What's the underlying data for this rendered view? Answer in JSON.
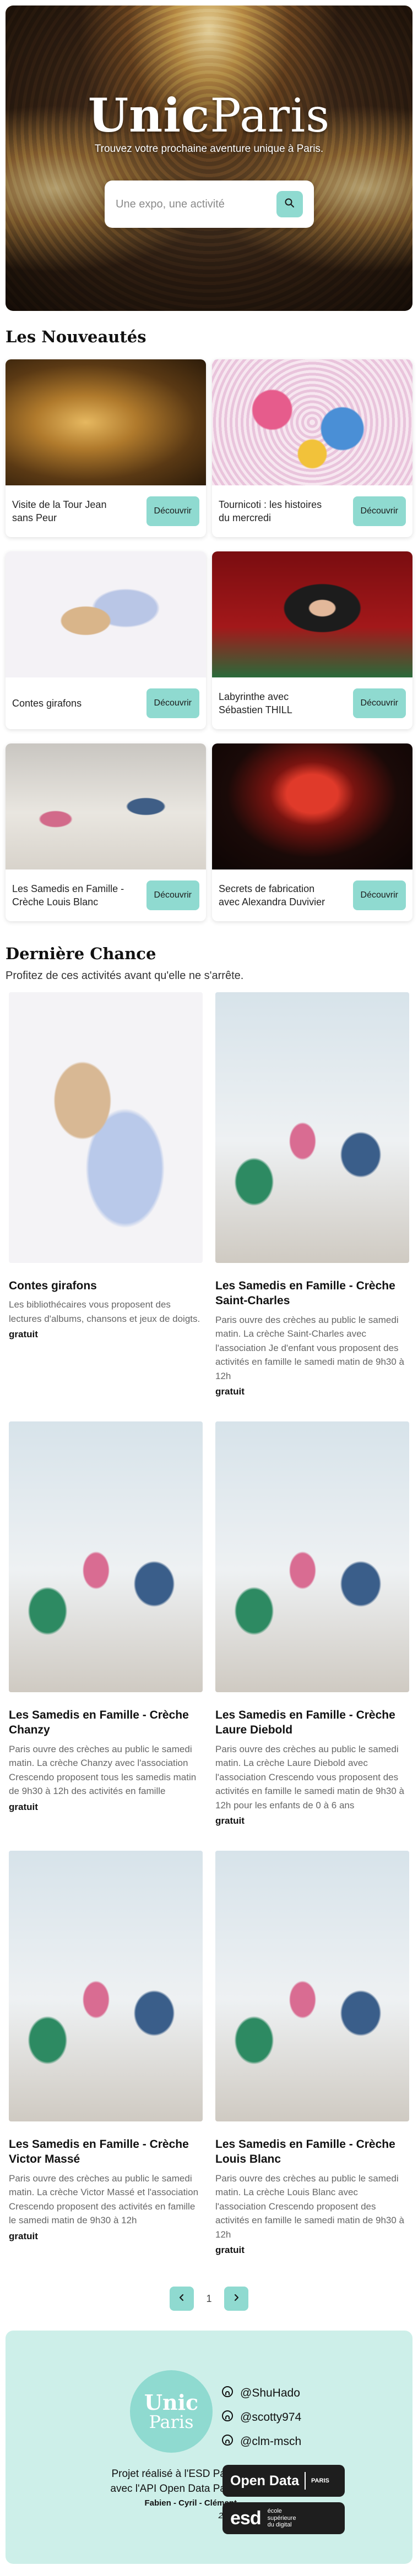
{
  "hero": {
    "logo_bold": "Unic",
    "logo_light": "Paris",
    "tagline": "Trouvez votre prochaine aventure unique à Paris.",
    "search_placeholder": "Une expo, une activité",
    "search_icon": "search-icon"
  },
  "nouveautes": {
    "title": "Les Nouveautés",
    "button_label": "Découvrir",
    "items": [
      {
        "title": "Visite de la Tour Jean sans Peur"
      },
      {
        "title": "Tournicoti : les histoires du mercredi"
      },
      {
        "title": "Contes girafons"
      },
      {
        "title": "Labyrinthe avec Sébastien THILL"
      },
      {
        "title": "Les Samedis en Famille - Crèche Louis Blanc"
      },
      {
        "title": "Secrets de fabrication avec Alexandra Duvivier"
      }
    ]
  },
  "derniere_chance": {
    "title": "Dernière Chance",
    "subtitle": "Profitez de ces activités avant qu'elle ne s'arrête.",
    "items": [
      {
        "title": "Contes girafons",
        "description": "Les bibliothécaires vous proposent des lectures d'albums, chansons et jeux de doigts.",
        "price": "gratuit"
      },
      {
        "title": "Les Samedis en Famille - Crèche Saint-Charles",
        "description": "Paris ouvre des crèches au public le samedi matin. La crèche Saint-Charles avec l'association Je d'enfant vous proposent des activités en famille le samedi matin de 9h30 à 12h",
        "price": "gratuit"
      },
      {
        "title": "Les Samedis en Famille - Crèche Chanzy",
        "description": "Paris ouvre des crèches au public le samedi matin. La crèche Chanzy avec l'association Crescendo proposent tous les samedis matin de 9h30 à 12h des activités en famille",
        "price": "gratuit"
      },
      {
        "title": "Les Samedis en Famille - Crèche Laure Diebold",
        "description": "Paris ouvre des crèches au public le samedi matin. La crèche Laure Diebold avec l'association Crescendo vous proposent des activités en famille le samedi matin de 9h30 à 12h pour les enfants de 0 à 6 ans",
        "price": "gratuit"
      },
      {
        "title": "Les Samedis en Famille - Crèche Victor Massé",
        "description": "Paris ouvre des crèches au public le samedi matin. La crèche Victor Massé et l'association Crescendo proposent des activités en famille le samedi matin de 9h30 à 12h",
        "price": "gratuit"
      },
      {
        "title": "Les Samedis en Famille - Crèche Louis Blanc",
        "description": "Paris ouvre des crèches au public le samedi matin. La crèche Louis Blanc avec l'association Crescendo proposent des activités en famille le samedi matin de 9h30 à 12h",
        "price": "gratuit"
      }
    ]
  },
  "pagination": {
    "current_page": "1",
    "prev_icon": "chevron-left-icon",
    "next_icon": "chevron-right-icon"
  },
  "footer": {
    "logo_bold": "Unic",
    "logo_light": "Paris",
    "handles": [
      "@ShuHado",
      "@scotty974",
      "@clm-msch"
    ],
    "line1": "Projet réalisé à l'ESD Paris",
    "line2": "avec l'API Open Data Paris",
    "names": "Fabien - Cyril - Clément",
    "year": "2023",
    "opendata_label": "Open Data",
    "opendata_paris": "PARIS",
    "esd_label": "esd",
    "esd_sub": "école\nsupérieure\ndu digital"
  },
  "colors": {
    "accent": "#8fdad0",
    "footer_bg": "#cdefe9",
    "badge_bg": "#1e1e1e"
  }
}
